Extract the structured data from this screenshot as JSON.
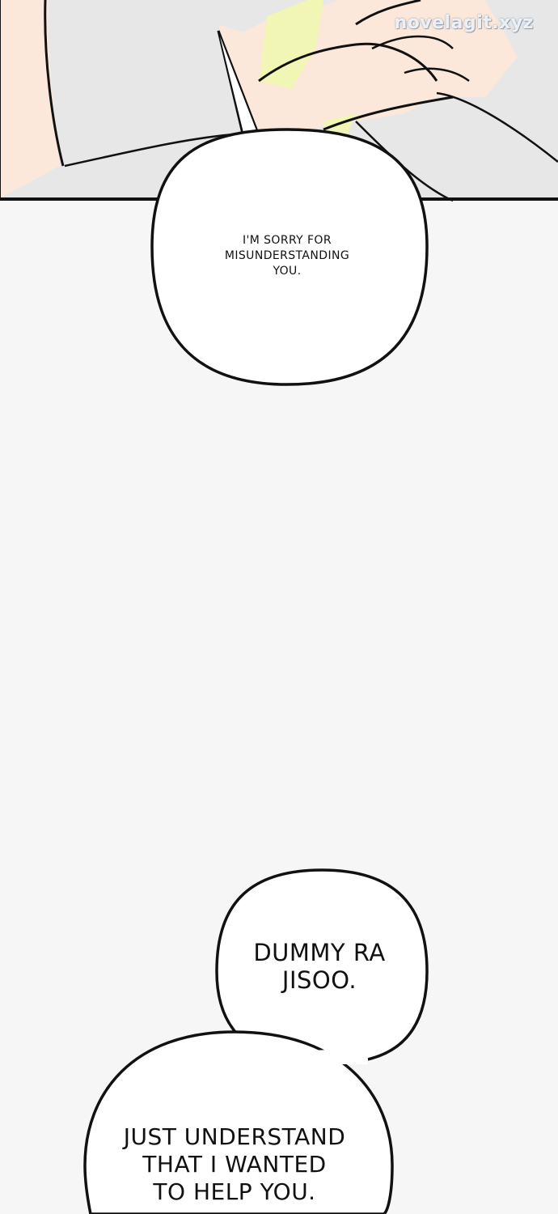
{
  "watermark": {
    "text": "novelagit.xyz"
  },
  "speech_bubbles": [
    {
      "text": "I'M SORRY FOR\nMISUNDERSTANDING\nYOU."
    },
    {
      "text": "DUMMY RA\nJISOO."
    },
    {
      "text": "JUST UNDERSTAND\nTHAT I WANTED\nTO HELP YOU."
    }
  ],
  "colors": {
    "background": "#f6f6f6",
    "panel_bg": "#e6e7e6",
    "skin": "#fbe7d8",
    "shirt_yellow": "#f1f6b4",
    "ink": "#111111",
    "bubble_fill": "#ffffff"
  }
}
